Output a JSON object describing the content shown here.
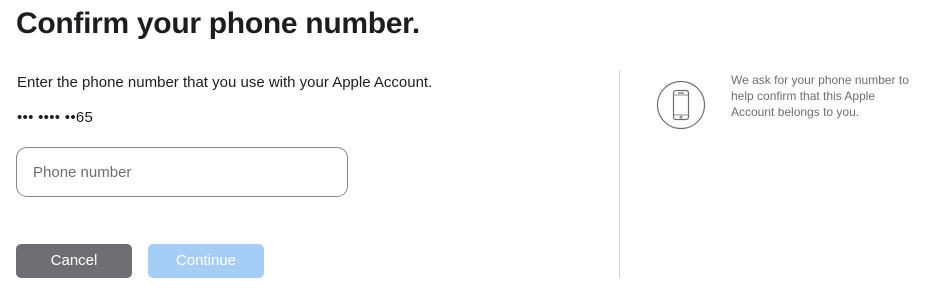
{
  "page": {
    "title": "Confirm your phone number."
  },
  "form": {
    "instruction": "Enter the phone number that you use with your Apple Account.",
    "masked_phone": "••• •••• ••65",
    "phone_input": {
      "placeholder": "Phone number",
      "value": ""
    }
  },
  "buttons": {
    "cancel_label": "Cancel",
    "continue_label": "Continue"
  },
  "info": {
    "icon": "iphone-icon",
    "text": "We ask for your phone number to help confirm that this Apple Account belongs to you."
  },
  "colors": {
    "cancel_bg": "#6e6e73",
    "continue_bg_disabled": "#a6cdf5",
    "text_primary": "#1d1d1f",
    "text_secondary": "#6e6e73"
  }
}
